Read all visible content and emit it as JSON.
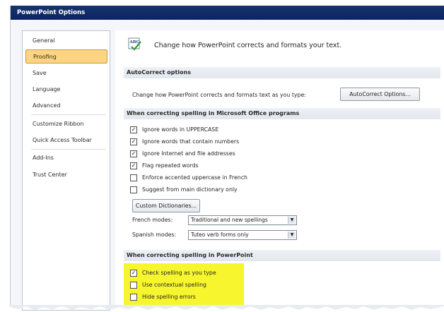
{
  "window": {
    "title": "PowerPoint Options"
  },
  "sidebar": {
    "items": [
      {
        "label": "General"
      },
      {
        "label": "Proofing"
      },
      {
        "label": "Save"
      },
      {
        "label": "Language"
      },
      {
        "label": "Advanced"
      },
      {
        "label": "Customize Ribbon"
      },
      {
        "label": "Quick Access Toolbar"
      },
      {
        "label": "Add-Ins"
      },
      {
        "label": "Trust Center"
      }
    ],
    "selected": "Proofing"
  },
  "header": {
    "text": "Change how PowerPoint corrects and formats your text.",
    "icon": "abc-checkmark-icon"
  },
  "autocorrect": {
    "heading": "AutoCorrect options",
    "description": "Change how PowerPoint corrects and formats text as you type:",
    "button_label": "AutoCorrect Options..."
  },
  "office_spelling": {
    "heading": "When correcting spelling in Microsoft Office programs",
    "options": [
      {
        "label": "Ignore words in UPPERCASE",
        "checked": "✓"
      },
      {
        "label": "Ignore words that contain numbers",
        "checked": "✓"
      },
      {
        "label": "Ignore Internet and file addresses",
        "checked": "✓"
      },
      {
        "label": "Flag repeated words",
        "checked": "✓"
      },
      {
        "label": "Enforce accented uppercase in French",
        "checked": ""
      },
      {
        "label": "Suggest from main dictionary only",
        "checked": ""
      }
    ],
    "custom_dictionaries_label": "Custom Dictionaries...",
    "french_modes_label": "French modes:",
    "french_modes_value": "Traditional and new spellings",
    "spanish_modes_label": "Spanish modes:",
    "spanish_modes_value": "Tuteo verb forms only"
  },
  "ppt_spelling": {
    "heading": "When correcting spelling in PowerPoint",
    "options": [
      {
        "label": "Check spelling as you type",
        "checked": "✓"
      },
      {
        "label": "Use contextual spelling",
        "checked": ""
      },
      {
        "label": "Hide spelling errors",
        "checked": ""
      }
    ]
  },
  "colors": {
    "title_bar": "#0c2460",
    "selected_nav": "#fdd482",
    "highlight": "#f7f52e"
  }
}
